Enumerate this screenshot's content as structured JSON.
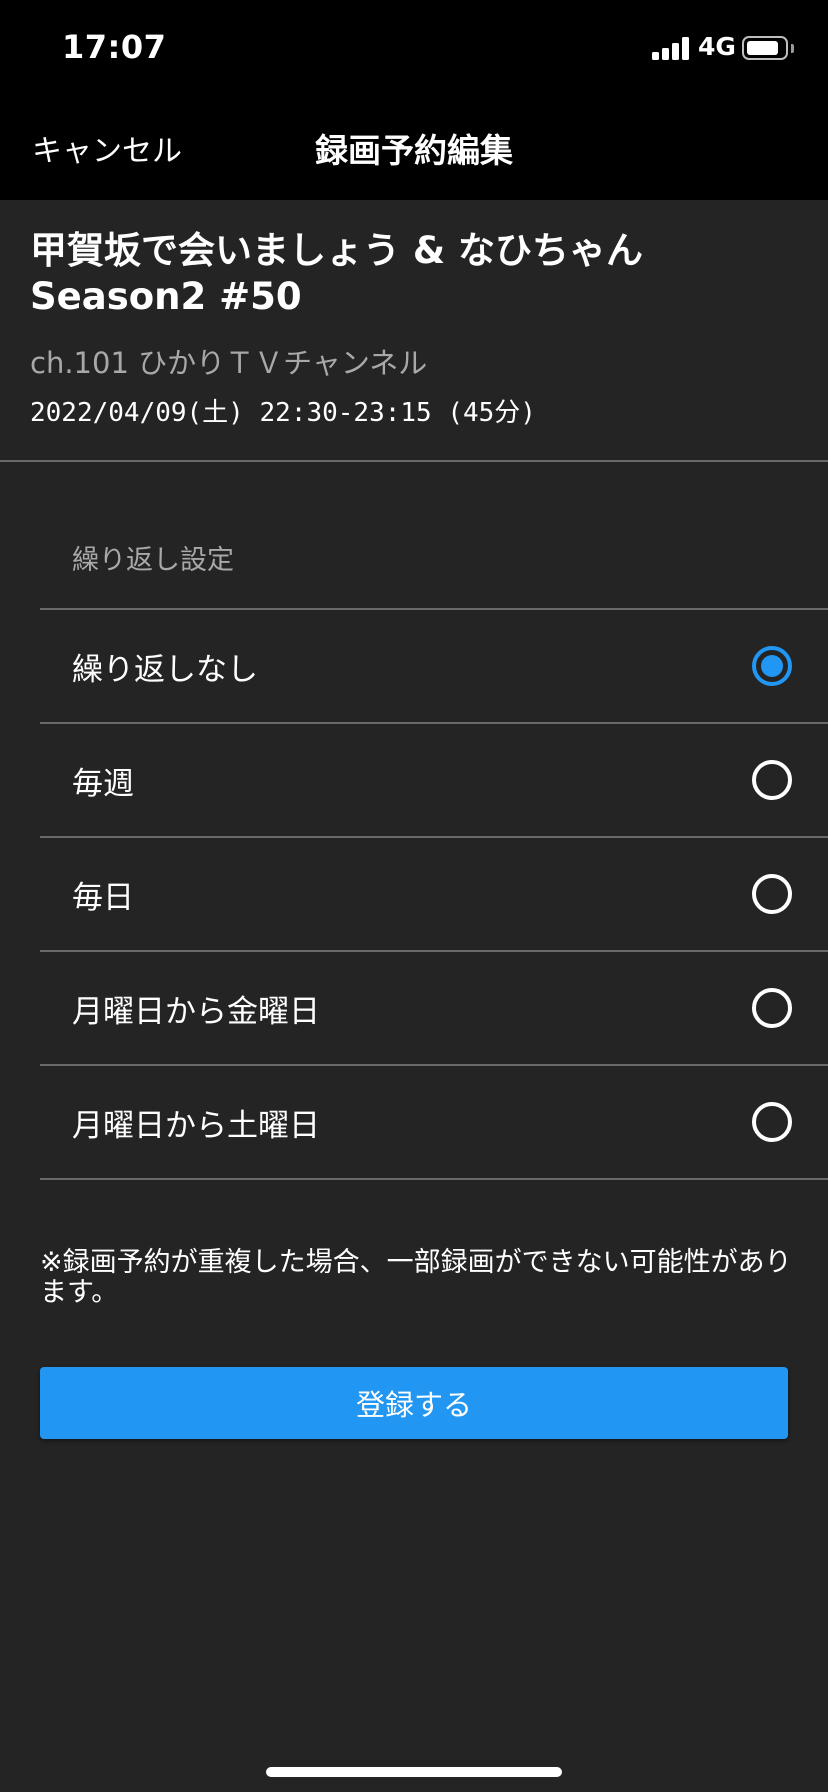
{
  "status_bar": {
    "time": "17:07",
    "network": "4G",
    "battery_level": 0.85
  },
  "nav": {
    "cancel_label": "キャンセル",
    "title": "録画予約編集"
  },
  "program": {
    "title": "甲賀坂で会いましょう & なひちゃん Season2 #50",
    "channel": "ch.101 ひかりＴＶチャンネル",
    "datetime": "2022/04/09(土) 22:30-23:15 (45分)"
  },
  "repeat_settings": {
    "header": "繰り返し設定",
    "selected_index": 0,
    "options": [
      {
        "label": "繰り返しなし",
        "selected": true
      },
      {
        "label": "毎週",
        "selected": false
      },
      {
        "label": "毎日",
        "selected": false
      },
      {
        "label": "月曜日から金曜日",
        "selected": false
      },
      {
        "label": "月曜日から土曜日",
        "selected": false
      }
    ]
  },
  "note": "※録画予約が重複した場合、一部録画ができない可能性があります。",
  "register_button_label": "登録する",
  "colors": {
    "accent": "#2196f3",
    "background": "#242424",
    "bar_background": "#000000",
    "secondary_text": "#a8a8a8",
    "divider": "#6a6a6a"
  }
}
